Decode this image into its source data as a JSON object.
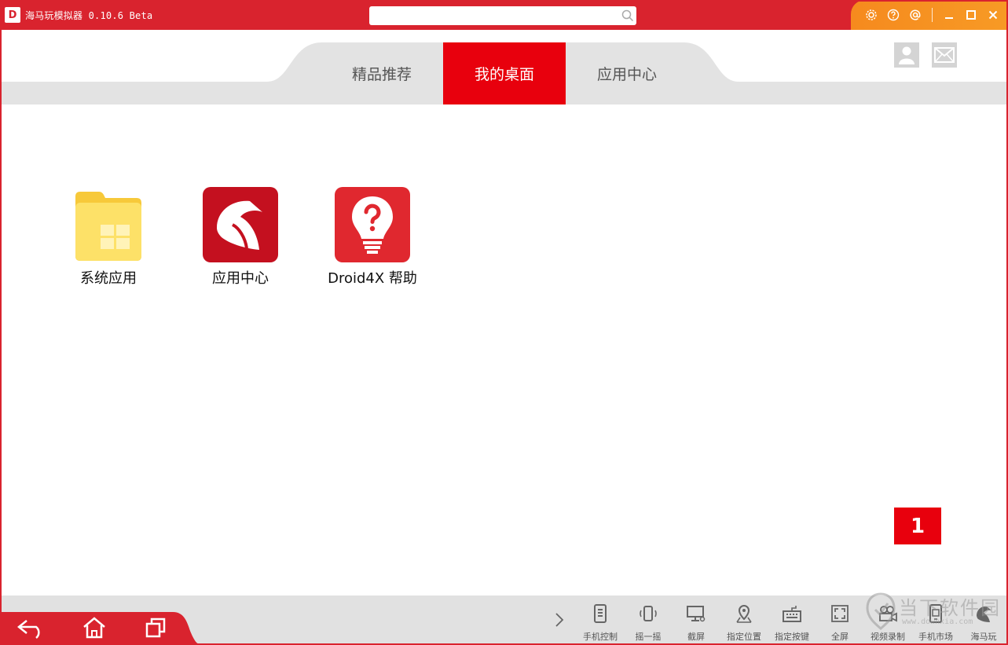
{
  "titlebar": {
    "logo_text": "D",
    "title": "海马玩模拟器 0.10.6 Beta",
    "search_value": "",
    "buttons": [
      "settings-icon",
      "help-icon",
      "at-icon",
      "minimize-icon",
      "maximize-icon",
      "close-icon"
    ]
  },
  "tabs": [
    {
      "label": "精品推荐",
      "active": false
    },
    {
      "label": "我的桌面",
      "active": true
    },
    {
      "label": "应用中心",
      "active": false
    }
  ],
  "desktop": {
    "apps": [
      {
        "label": "系统应用",
        "icon": "folder-icon"
      },
      {
        "label": "应用中心",
        "icon": "app-center-icon"
      },
      {
        "label": "Droid4X 帮助",
        "icon": "help-bulb-icon"
      }
    ],
    "page_number": "1"
  },
  "colors": {
    "brand_red": "#d9232e",
    "active_tab": "#e8000d",
    "orange": "#f68a1e"
  },
  "bottombar": {
    "nav": [
      "back-icon",
      "home-icon",
      "recent-apps-icon"
    ],
    "tools": [
      {
        "label": "手机控制",
        "icon": "phone-control-icon"
      },
      {
        "label": "摇一摇",
        "icon": "shake-icon"
      },
      {
        "label": "截屏",
        "icon": "screenshot-icon"
      },
      {
        "label": "指定位置",
        "icon": "location-icon"
      },
      {
        "label": "指定按键",
        "icon": "keyboard-icon"
      },
      {
        "label": "全屏",
        "icon": "fullscreen-icon"
      },
      {
        "label": "视频录制",
        "icon": "video-record-icon"
      },
      {
        "label": "手机市场",
        "icon": "market-icon"
      },
      {
        "label": "海马玩",
        "icon": "haima-icon"
      }
    ]
  },
  "watermark": {
    "text": "当下软件园",
    "url": "www.downxia.com"
  }
}
